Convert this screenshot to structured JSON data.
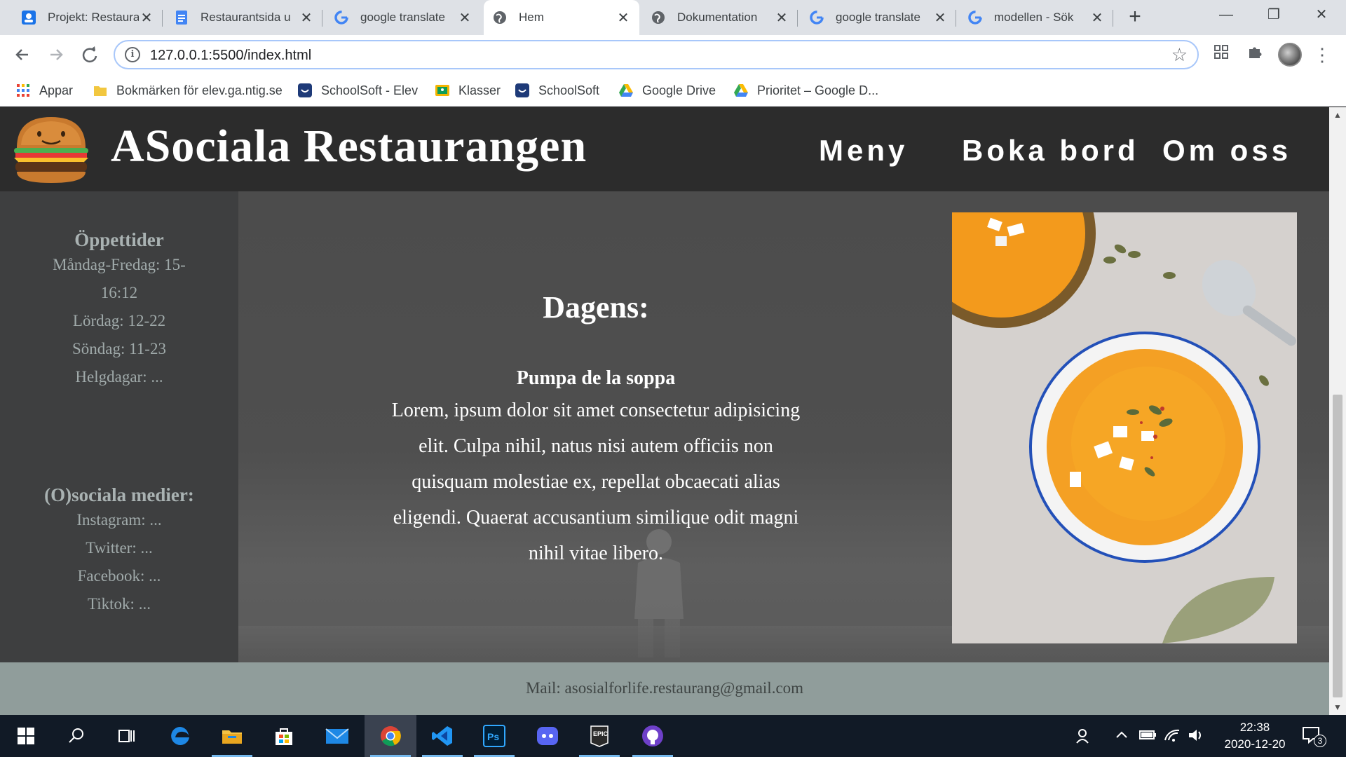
{
  "browser": {
    "tabs": [
      {
        "title": "Projekt: Restaurang",
        "icon": "classroom-icon",
        "active": false
      },
      {
        "title": "Restaurantsida u",
        "icon": "docs-icon",
        "active": false
      },
      {
        "title": "google translate",
        "icon": "google-icon",
        "active": false
      },
      {
        "title": "Hem",
        "icon": "globe-icon",
        "active": true
      },
      {
        "title": "Dokumentation",
        "icon": "globe-icon",
        "active": false
      },
      {
        "title": "google translate",
        "icon": "google-icon",
        "active": false
      },
      {
        "title": "modellen - Sök",
        "icon": "google-icon",
        "active": false
      }
    ],
    "new_tab": "+",
    "window_controls": {
      "minimize": "—",
      "restore": "❐",
      "close": "✕"
    },
    "url": "127.0.0.1:5500/index.html",
    "bookmarks": [
      {
        "label": "Appar",
        "icon": "apps-grid-icon"
      },
      {
        "label": "Bokmärken för elev.ga.ntig.se",
        "icon": "folder-icon"
      },
      {
        "label": "SchoolSoft - Elev",
        "icon": "schoolsoft-icon"
      },
      {
        "label": "Klasser",
        "icon": "classroom-icon"
      },
      {
        "label": "SchoolSoft",
        "icon": "schoolsoft-icon"
      },
      {
        "label": "Google Drive",
        "icon": "drive-icon"
      },
      {
        "label": "Prioritet – Google D...",
        "icon": "drive-icon"
      }
    ]
  },
  "site": {
    "title": "ASociala Restaurangen",
    "nav": [
      "Meny",
      "Boka bord",
      "Om oss"
    ],
    "sidebar": {
      "hours_heading": "Öppettider",
      "hours": [
        "Måndag-Fredag: 15-",
        "16:12",
        "Lördag: 12-22",
        "Söndag: 11-23",
        "Helgdagar: ..."
      ],
      "social_heading": "(O)sociala medier:",
      "social": [
        "Instagram: ...",
        "Twitter: ...",
        "Facebook: ...",
        "Tiktok: ..."
      ]
    },
    "dagens": {
      "heading": "Dagens:",
      "dish": "Pumpa de la soppa",
      "description_lines": [
        "Lorem, ipsum dolor sit amet consectetur adipisicing",
        "elit. Culpa nihil, natus nisi autem officiis non",
        "quisquam molestiae ex, repellat obcaecati alias",
        "eligendi. Quaerat accusantium similique odit magni",
        "nihil vitae libero."
      ]
    },
    "footer": "Mail: asosialforlife.restaurang@gmail.com"
  },
  "taskbar": {
    "apps": [
      "start-icon",
      "search-icon",
      "task-view-icon",
      "edge-icon",
      "file-explorer-icon",
      "store-icon",
      "mail-icon",
      "chrome-icon",
      "vscode-icon",
      "photoshop-icon",
      "discord-icon",
      "epic-games-icon",
      "github-icon"
    ],
    "time": "22:38",
    "date": "2020-12-20",
    "notification_count": "3"
  },
  "colors": {
    "header_bg": "#2c2c2c",
    "sidebar_bg": "#3e3f40",
    "footer_bg": "#909d9b",
    "accent_url_border": "#a8c7fa"
  }
}
